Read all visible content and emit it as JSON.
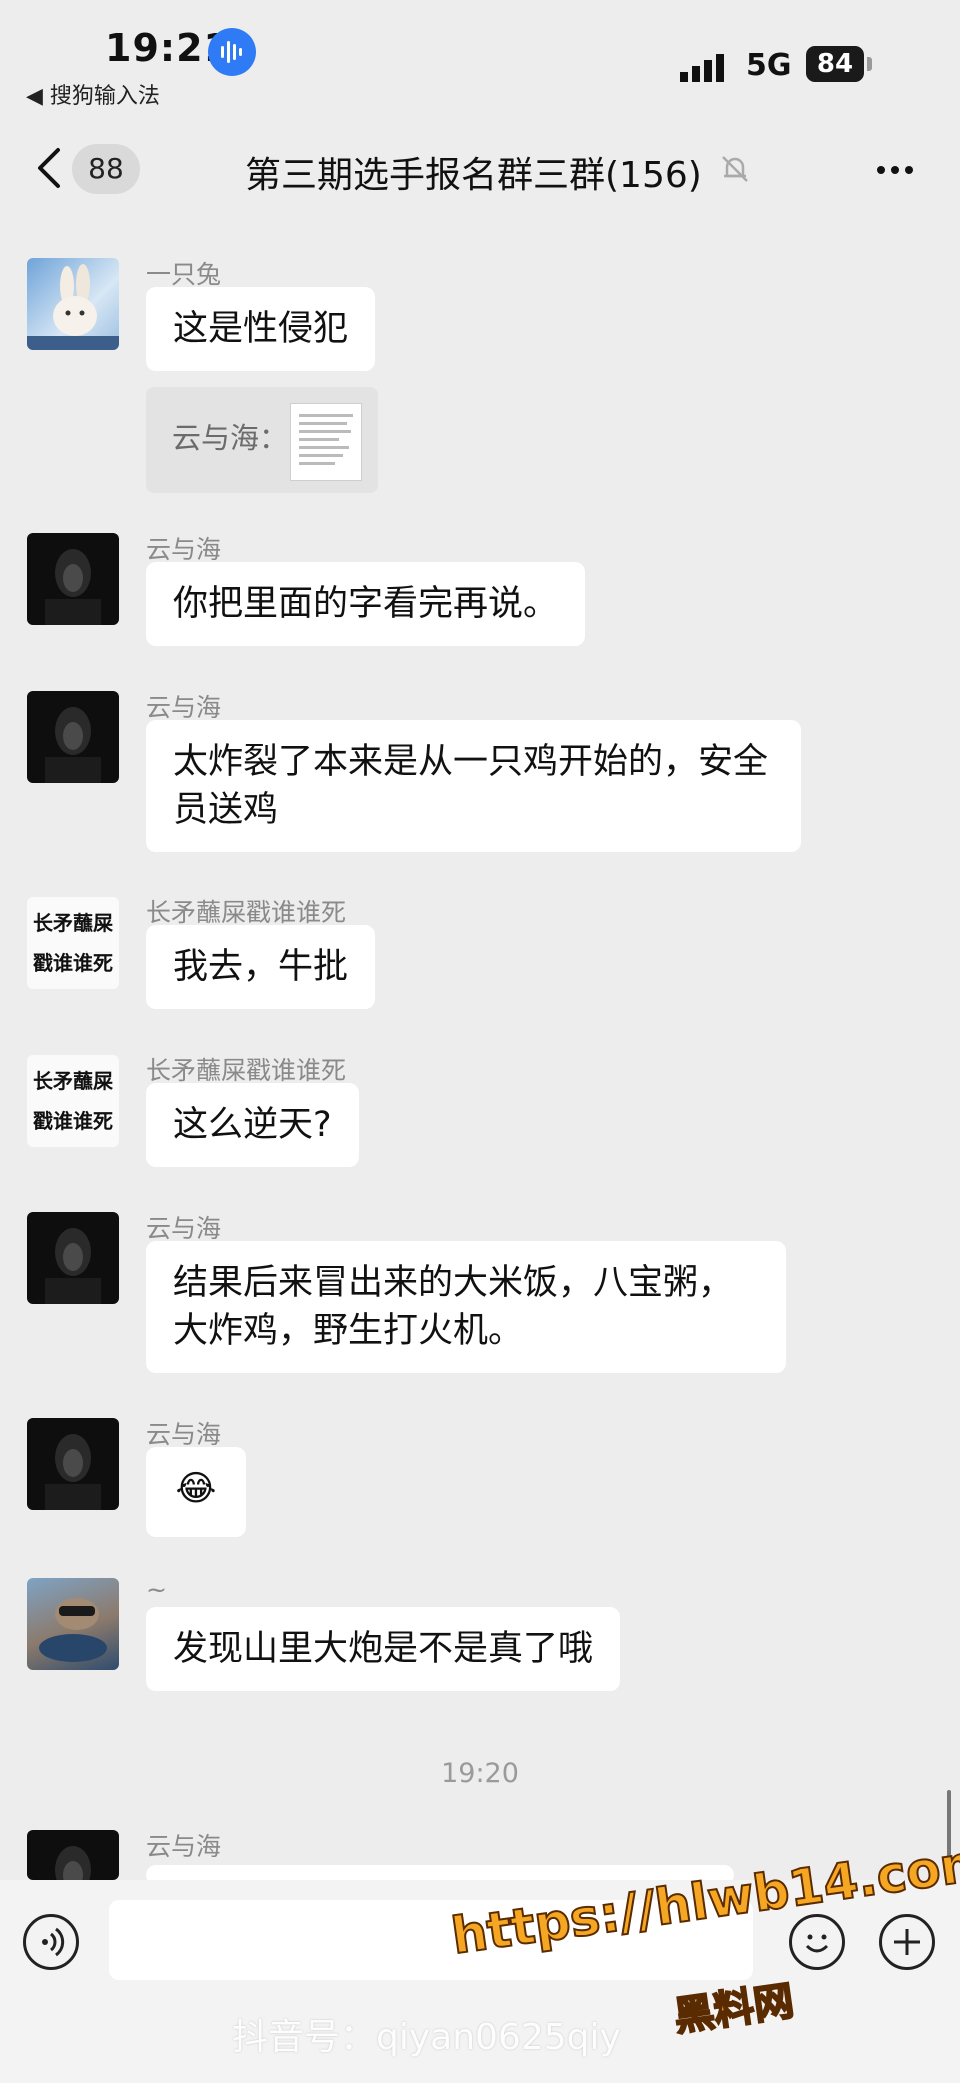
{
  "status_bar": {
    "time": "19:21",
    "back_app": "◀ 搜狗输入法",
    "network": "5G",
    "battery": "84"
  },
  "nav": {
    "unread_count": "88",
    "title": "第三期选手报名群三群(156)"
  },
  "messages": [
    {
      "sender": "一只兔",
      "text": "这是性侵犯"
    },
    {
      "quote_text": "云与海："
    },
    {
      "sender": "云与海",
      "text": "你把里面的字看完再说。"
    },
    {
      "sender": "云与海",
      "text": "太炸裂了本来是从一只鸡开始的，安全员送鸡"
    },
    {
      "sender": "长矛蘸屎戳谁谁死",
      "text": "我去，牛批",
      "avatar_text": [
        "长矛蘸屎",
        "戳谁谁死"
      ]
    },
    {
      "sender": "长矛蘸屎戳谁谁死",
      "text": "这么逆天?",
      "avatar_text": [
        "长矛蘸屎",
        "戳谁谁死"
      ]
    },
    {
      "sender": "云与海",
      "text": "结果后来冒出来的大米饭，八宝粥，大炸鸡，野生打火机。"
    },
    {
      "sender": "云与海",
      "text": "😂"
    },
    {
      "sender": "~",
      "text": "发现山里大炮是不是真了哦"
    },
    {
      "sender": "云与海",
      "text": ""
    }
  ],
  "time_separator": "19:20",
  "watermark": {
    "url": "https://hlwb14.com",
    "site_name": "黑料网",
    "douyin": "抖音号：qiyan0625qiy"
  },
  "colors": {
    "background": "#ededed",
    "bubble": "#ffffff",
    "accent_voice": "#2f7bf6",
    "watermark": "#f5a623"
  }
}
